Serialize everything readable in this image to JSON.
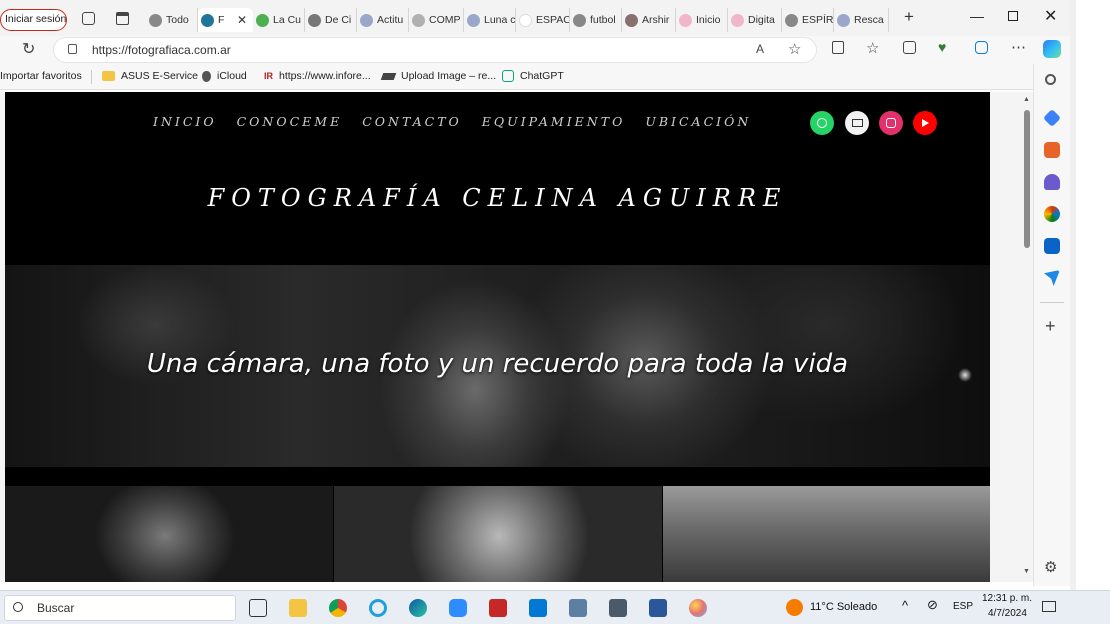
{
  "browser": {
    "signin_label": "Iniciar sesión",
    "tabs": [
      {
        "label": "Todo",
        "icon": "page-icon",
        "color": "#888888"
      },
      {
        "label": "F",
        "icon": "wordpress-icon",
        "color": "#21759b",
        "active": true
      },
      {
        "label": "La Cu",
        "icon": "leaf-icon",
        "color": "#4caf50"
      },
      {
        "label": "De Ci",
        "icon": "image-icon",
        "color": "#777777"
      },
      {
        "label": "Actitu",
        "icon": "wordpress-icon",
        "color": "#9aa7c8"
      },
      {
        "label": "COMP",
        "icon": "circle-icon",
        "color": "#b0b0b0"
      },
      {
        "label": "Luna c",
        "icon": "wordpress-icon",
        "color": "#9aa7c8"
      },
      {
        "label": "ESPAC",
        "icon": "blank-icon",
        "color": "#ffffff"
      },
      {
        "label": "futbol",
        "icon": "document-icon",
        "color": "#888888"
      },
      {
        "label": "Arshir",
        "icon": "image-icon",
        "color": "#8a6f6f"
      },
      {
        "label": "Inicio",
        "icon": "cloud-icon",
        "color": "#f2b6c9"
      },
      {
        "label": "Digita",
        "icon": "heart-icon",
        "color": "#f2b6c9"
      },
      {
        "label": "ESPÍR",
        "icon": "document-icon",
        "color": "#888888"
      },
      {
        "label": "Resca",
        "icon": "wordpress-icon",
        "color": "#9aa7c8"
      }
    ],
    "url": "https://fotografiaca.com.ar",
    "favorites": [
      {
        "label": "Importar favoritos",
        "icon": "none"
      },
      {
        "label": "ASUS E-Service",
        "icon": "folder-icon"
      },
      {
        "label": "iCloud",
        "icon": "apple-icon"
      },
      {
        "label": "https://www.infore...",
        "icon": "ir-icon"
      },
      {
        "label": "Upload Image – re...",
        "icon": "layers-icon"
      },
      {
        "label": "ChatGPT",
        "icon": "chatgpt-icon"
      }
    ]
  },
  "site": {
    "nav": [
      "INICIO",
      "CONOCEME",
      "CONTACTO",
      "EQUIPAMIENTO",
      "UBICACIÓN"
    ],
    "social": [
      {
        "name": "whatsapp",
        "color": "#25d366"
      },
      {
        "name": "email",
        "color": "#f2f2f2"
      },
      {
        "name": "instagram",
        "color": "#e1306c"
      },
      {
        "name": "youtube",
        "color": "#ff0000"
      }
    ],
    "title": "FOTOGRAFÍA CELINA AGUIRRE",
    "hero_caption": "Una cámara, una foto y un recuerdo para toda la vida"
  },
  "taskbar": {
    "search_placeholder": "Buscar",
    "weather": "11°C  Soleado",
    "lang": "ESP",
    "time": "12:31 p. m.",
    "date": "4/7/2024"
  }
}
